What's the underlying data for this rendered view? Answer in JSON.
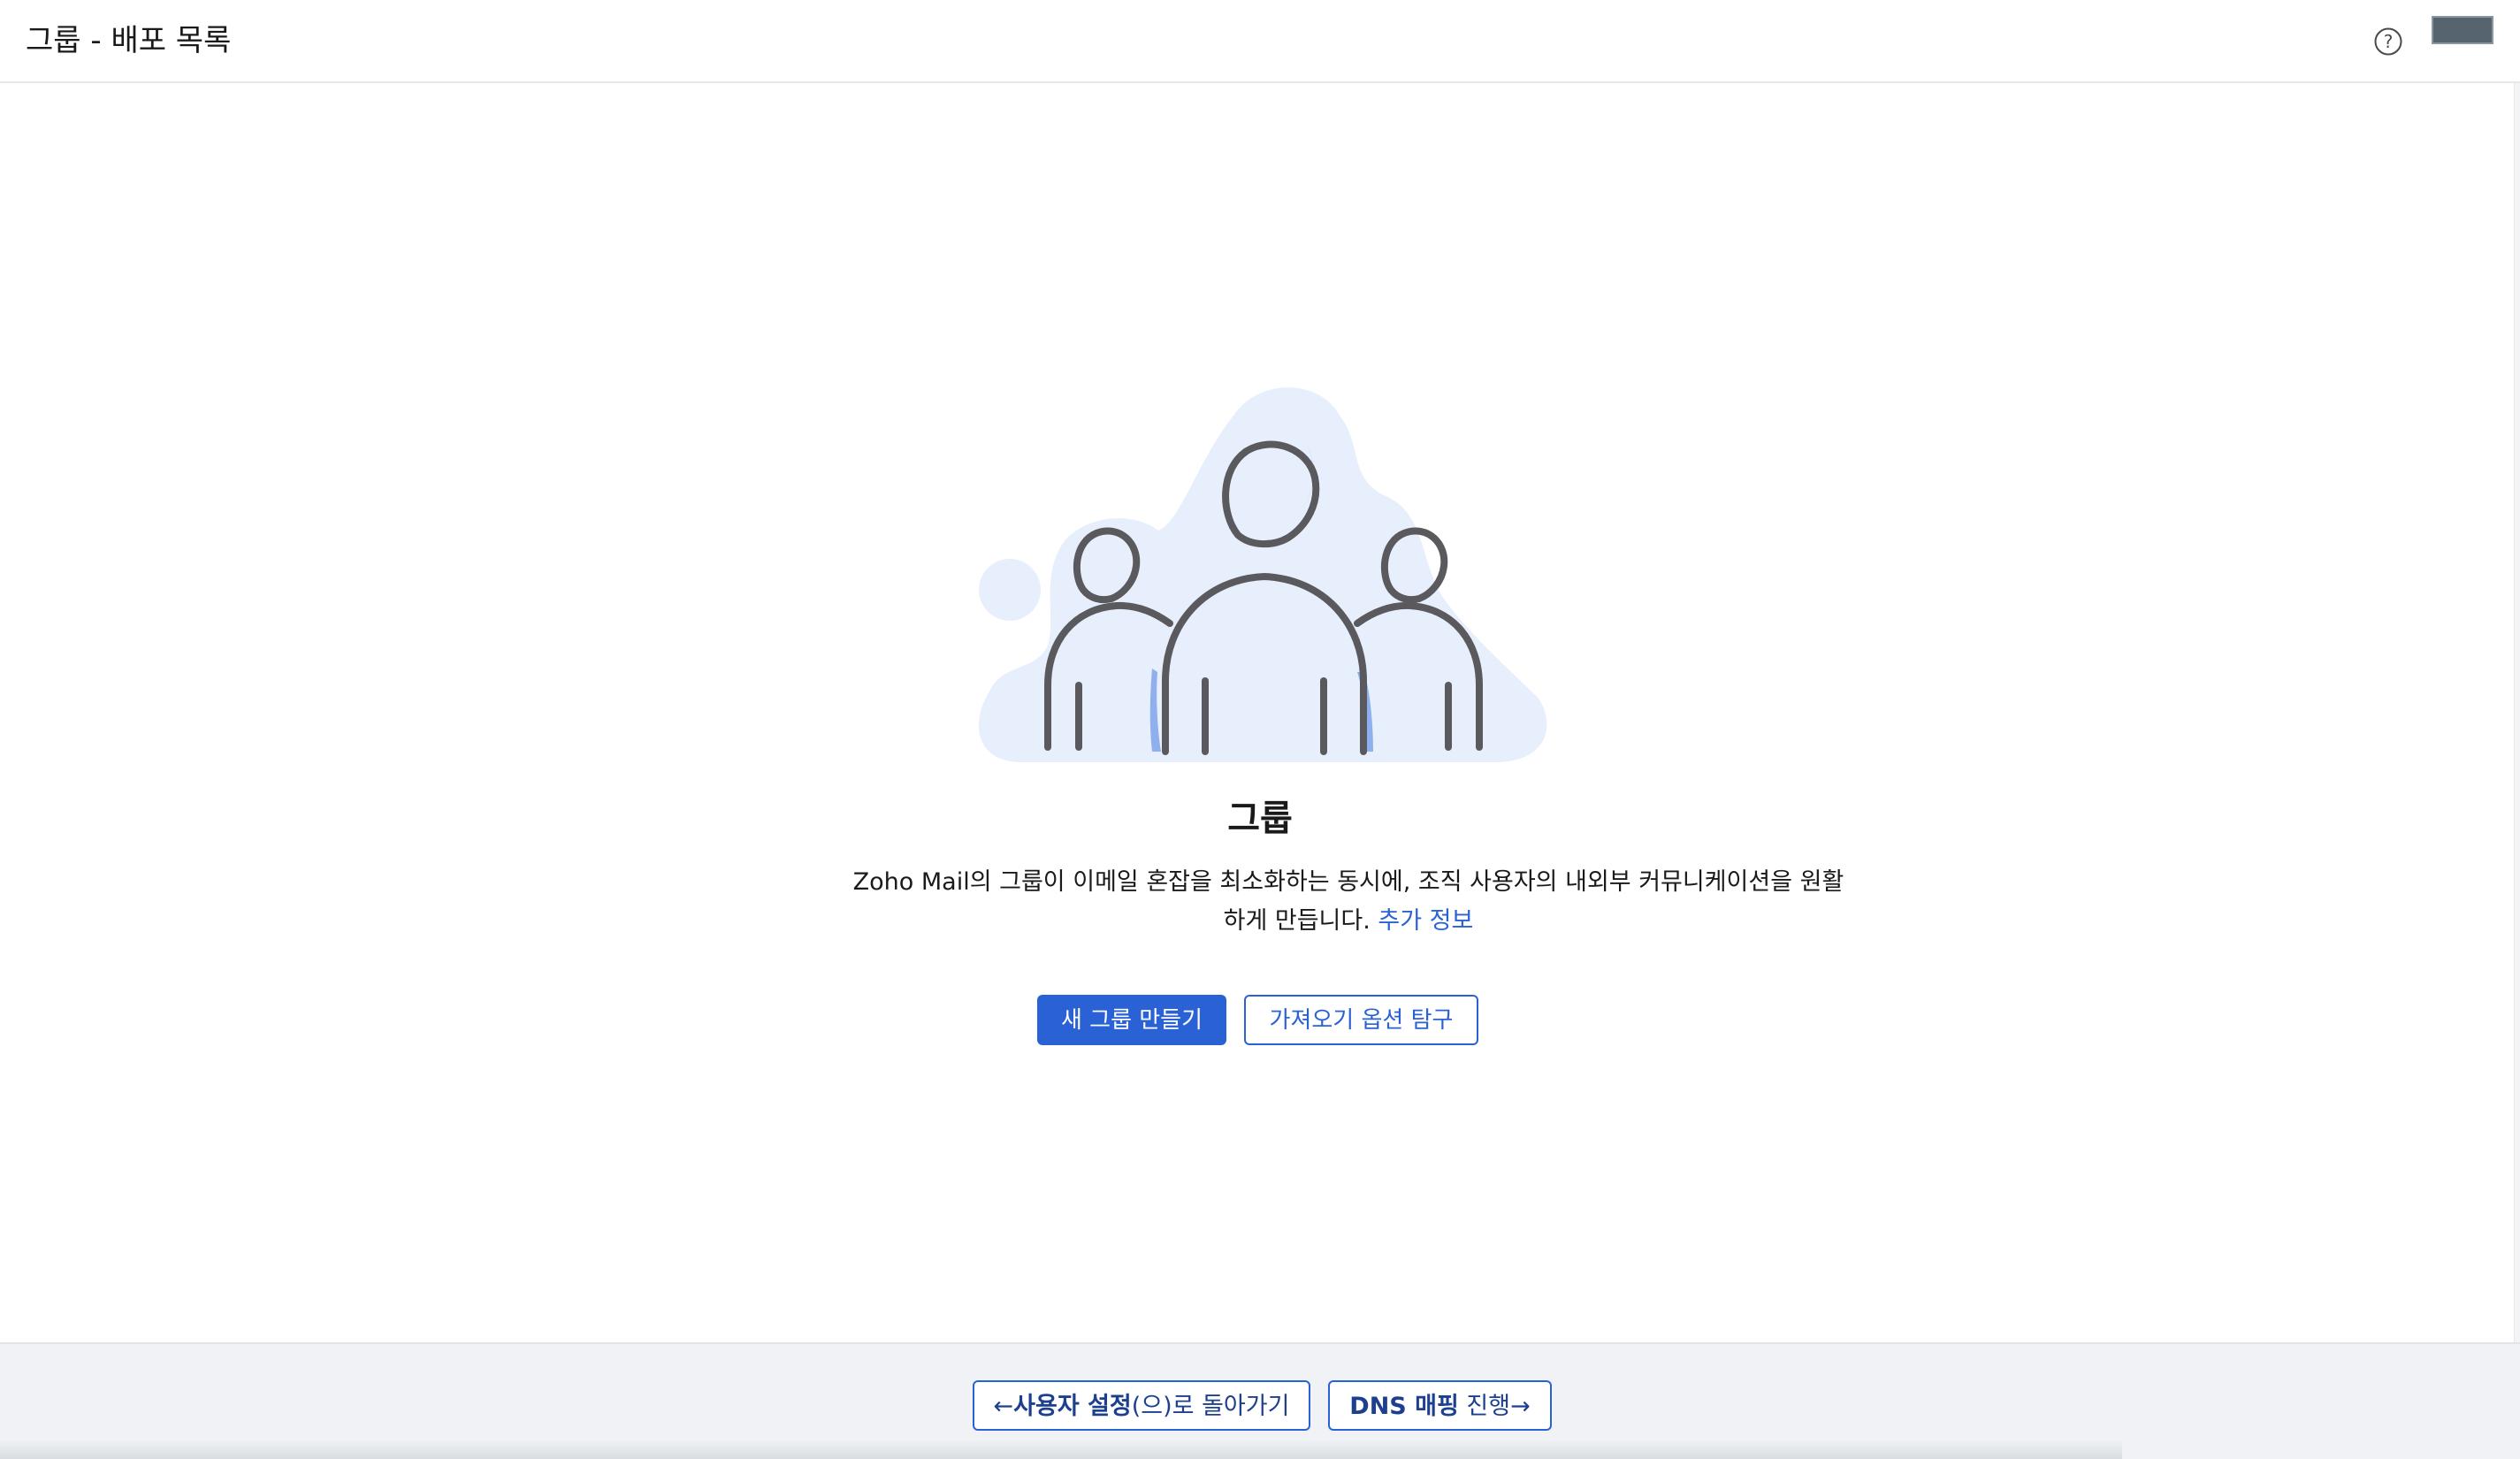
{
  "header": {
    "title": "그룹 - 배포 목록",
    "help_icon": "question-circle-icon"
  },
  "main": {
    "illustration": "group-people-illustration",
    "title": "그룹",
    "description_line1": "Zoho Mail의 그룹이 이메일 혼잡을 최소화하는 동시에, 조직 사용자의 내외부 커뮤니케이션을 원활",
    "description_line2": "하게 만듭니다.",
    "more_info_link": "추가 정보",
    "create_button": "새 그룹 만들기",
    "import_button": "가져오기 옵션 탐구"
  },
  "footer": {
    "back_arrow": "←",
    "back_bold": "사용자 설정",
    "back_rest": "(으)로 돌아가기",
    "next_bold": "DNS 매핑",
    "next_rest": " 진행",
    "next_arrow": "→"
  },
  "colors": {
    "accent": "#2a62d6",
    "illustration_bg": "#e8effc",
    "illustration_stroke": "#5a5a5e",
    "illustration_accent": "#8fb0ec"
  }
}
